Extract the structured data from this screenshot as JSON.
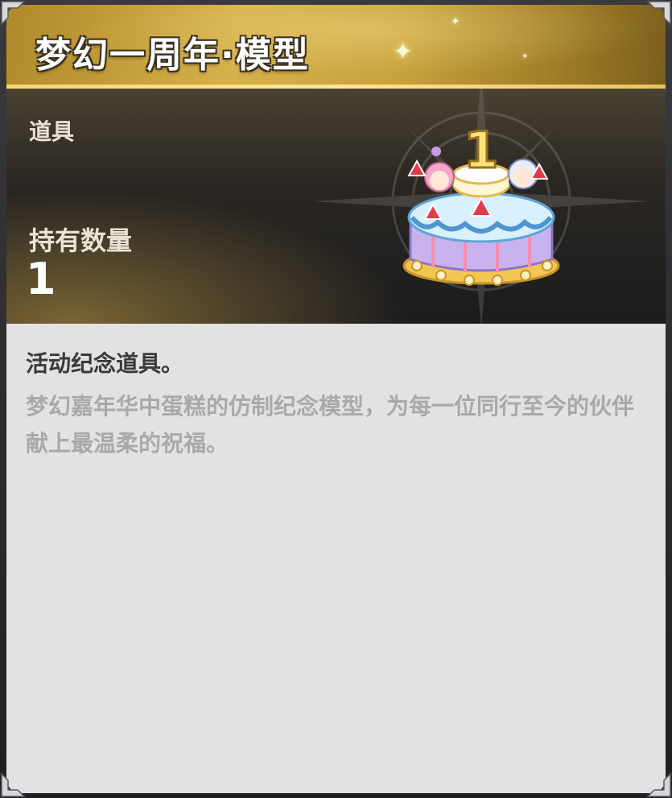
{
  "title": "梦幻一周年·模型",
  "info": {
    "category_label": "道具",
    "quantity_label": "持有数量",
    "quantity_value": "1",
    "item_icon": "birthday-cake-icon"
  },
  "description": {
    "heading": "活动纪念道具。",
    "body": "梦幻嘉年华中蛋糕的仿制纪念模型，为每一位同行至今的伙伴献上最温柔的祝福。"
  },
  "colors": {
    "title_gold": "#d6b04a",
    "panel_dark": "#1c1c1e",
    "desc_bg": "#e2e2e2",
    "heading_text": "#3a3a3a",
    "body_text": "#a9a9a9"
  }
}
